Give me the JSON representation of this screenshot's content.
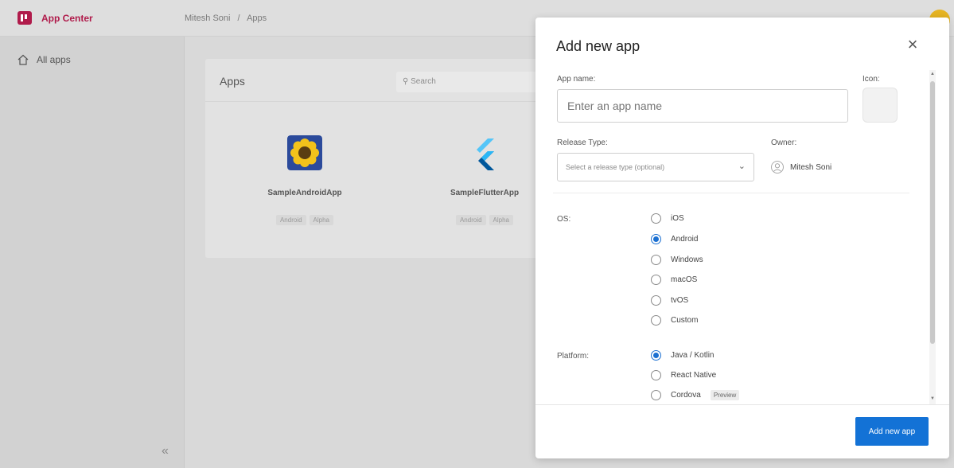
{
  "header": {
    "app_title": "App Center",
    "breadcrumb": {
      "owner": "Mitesh Soni",
      "separator": "/",
      "page": "Apps"
    }
  },
  "sidebar": {
    "items": [
      {
        "label": "All apps",
        "icon": "home-icon"
      }
    ],
    "collapse_glyph": "«"
  },
  "main": {
    "panel_title": "Apps",
    "search_placeholder": "Search",
    "apps": [
      {
        "name": "SampleAndroidApp",
        "tags": [
          "Android",
          "Alpha"
        ],
        "icon": "sunflower-app-icon"
      },
      {
        "name": "SampleFlutterApp",
        "tags": [
          "Android",
          "Alpha"
        ],
        "icon": "flutter-app-icon"
      }
    ]
  },
  "modal": {
    "title": "Add new app",
    "close_glyph": "×",
    "app_name_label": "App name:",
    "app_name_placeholder": "Enter an app name",
    "icon_label": "Icon:",
    "release_type_label": "Release Type:",
    "release_type_placeholder": "Select a release type (optional)",
    "owner_label": "Owner:",
    "owner_name": "Mitesh Soni",
    "os_label": "OS:",
    "os_options": [
      {
        "label": "iOS",
        "selected": false
      },
      {
        "label": "Android",
        "selected": true
      },
      {
        "label": "Windows",
        "selected": false
      },
      {
        "label": "macOS",
        "selected": false
      },
      {
        "label": "tvOS",
        "selected": false
      },
      {
        "label": "Custom",
        "selected": false
      }
    ],
    "platform_label": "Platform:",
    "platform_options": [
      {
        "label": "Java / Kotlin",
        "selected": true
      },
      {
        "label": "React Native",
        "selected": false
      },
      {
        "label": "Cordova",
        "selected": false,
        "badge": "Preview"
      }
    ],
    "submit_label": "Add new app"
  },
  "colors": {
    "brand": "#b01b4b",
    "primary": "#1372d6",
    "avatar": "#e6b422"
  }
}
